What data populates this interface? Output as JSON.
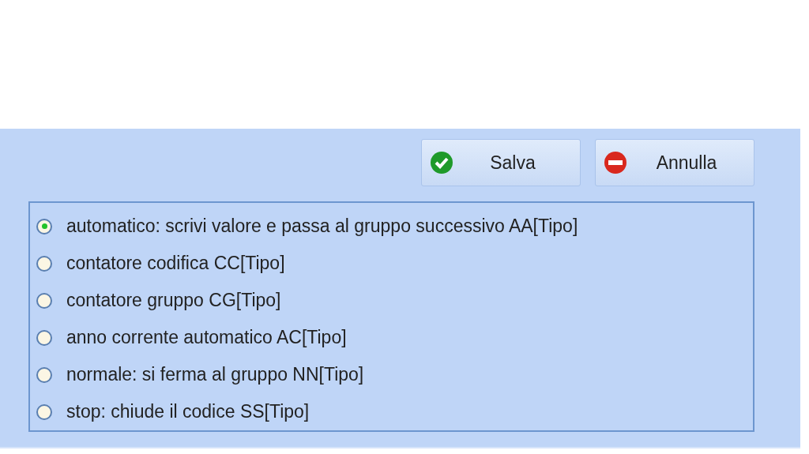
{
  "buttons": [
    {
      "kind": "save",
      "label": "Salva"
    },
    {
      "kind": "cancel",
      "label": "Annulla"
    }
  ],
  "options": [
    {
      "label": "automatico: scrivi valore e passa al gruppo successivo AA[Tipo]",
      "selected": true
    },
    {
      "label": "contatore codifica CC[Tipo]",
      "selected": false
    },
    {
      "label": "contatore gruppo CG[Tipo]",
      "selected": false
    },
    {
      "label": "anno corrente automatico AC[Tipo]",
      "selected": false
    },
    {
      "label": "normale: si ferma al gruppo NN[Tipo]",
      "selected": false
    },
    {
      "label": "stop: chiude il codice SS[Tipo]",
      "selected": false
    }
  ]
}
